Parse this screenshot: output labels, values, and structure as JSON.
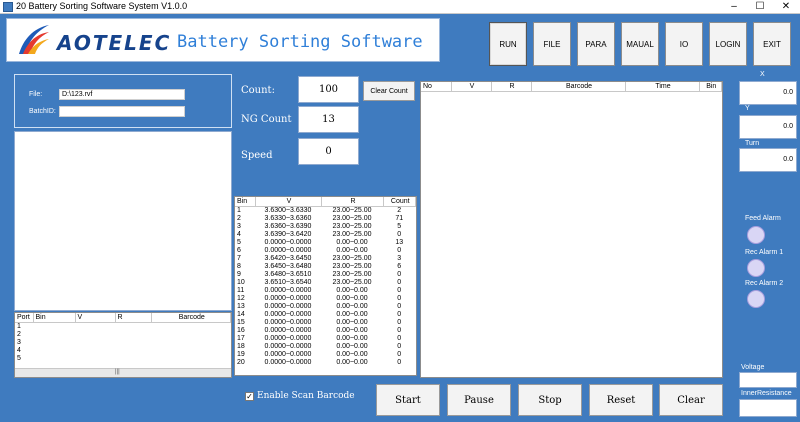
{
  "window": {
    "title": "20 Battery Sorting Software System V1.0.0",
    "minimize": "–",
    "maximize": "☐",
    "close": "✕"
  },
  "brand": {
    "logo": "AOTELEC",
    "title": "Battery Sorting Software"
  },
  "toolbar": [
    "RUN",
    "FILE",
    "PARA",
    "MAUAL",
    "IO",
    "LOGIN",
    "EXIT"
  ],
  "file_panel": {
    "file_label": "File:",
    "file_value": "D:\\123.rvf",
    "batch_label": "BatchID:",
    "batch_value": ""
  },
  "port_table": {
    "headers": [
      "Port",
      "Bin",
      "V",
      "R",
      "Barcode"
    ],
    "rows": [
      "1",
      "2",
      "3",
      "4",
      "5"
    ],
    "scroll_glyph": "|||"
  },
  "stats": {
    "count_label": "Count:",
    "count_value": "100",
    "ng_label": "NG Count",
    "ng_value": "13",
    "speed_label": "Speed",
    "speed_value": "0",
    "clear_count": "Clear Count"
  },
  "bin_table": {
    "headers": [
      "Bin",
      "V",
      "R",
      "Count"
    ],
    "rows": [
      [
        "1",
        "3.6300~3.6330",
        "23.00~25.00",
        "2"
      ],
      [
        "2",
        "3.6330~3.6360",
        "23.00~25.00",
        "71"
      ],
      [
        "3",
        "3.6360~3.6390",
        "23.00~25.00",
        "5"
      ],
      [
        "4",
        "3.6390~3.6420",
        "23.00~25.00",
        "0"
      ],
      [
        "5",
        "0.0000~0.0000",
        "0.00~0.00",
        "13"
      ],
      [
        "6",
        "0.0000~0.0000",
        "0.00~0.00",
        "0"
      ],
      [
        "7",
        "3.6420~3.6450",
        "23.00~25.00",
        "3"
      ],
      [
        "8",
        "3.6450~3.6480",
        "23.00~25.00",
        "6"
      ],
      [
        "9",
        "3.6480~3.6510",
        "23.00~25.00",
        "0"
      ],
      [
        "10",
        "3.6510~3.6540",
        "23.00~25.00",
        "0"
      ],
      [
        "11",
        "0.0000~0.0000",
        "0.00~0.00",
        "0"
      ],
      [
        "12",
        "0.0000~0.0000",
        "0.00~0.00",
        "0"
      ],
      [
        "13",
        "0.0000~0.0000",
        "0.00~0.00",
        "0"
      ],
      [
        "14",
        "0.0000~0.0000",
        "0.00~0.00",
        "0"
      ],
      [
        "15",
        "0.0000~0.0000",
        "0.00~0.00",
        "0"
      ],
      [
        "16",
        "0.0000~0.0000",
        "0.00~0.00",
        "0"
      ],
      [
        "17",
        "0.0000~0.0000",
        "0.00~0.00",
        "0"
      ],
      [
        "18",
        "0.0000~0.0000",
        "0.00~0.00",
        "0"
      ],
      [
        "19",
        "0.0000~0.0000",
        "0.00~0.00",
        "0"
      ],
      [
        "20",
        "0.0000~0.0000",
        "0.00~0.00",
        "0"
      ]
    ]
  },
  "record_table": {
    "headers": [
      "No",
      "V",
      "R",
      "Barcode",
      "Time",
      "Bin"
    ]
  },
  "enable_scan": {
    "label": "Enable Scan Barcode",
    "checked": true
  },
  "actions": [
    "Start",
    "Pause",
    "Stop",
    "Reset",
    "Clear"
  ],
  "axes": [
    {
      "label": "X",
      "value": "0.0"
    },
    {
      "label": "Y",
      "value": "0.0"
    },
    {
      "label": "Turn",
      "value": "0.0"
    }
  ],
  "alarms": [
    "Feed Alarm",
    "Rec Alarm 1",
    "Rec Alarm 2"
  ],
  "meters": [
    {
      "label": "Voltage",
      "value": ""
    },
    {
      "label": "InnerResistance",
      "value": ""
    }
  ],
  "colors": {
    "background": "#3f7bbf",
    "logo": "#16438c",
    "title": "#2f7fd8",
    "alarm": "#d9d6f5"
  }
}
